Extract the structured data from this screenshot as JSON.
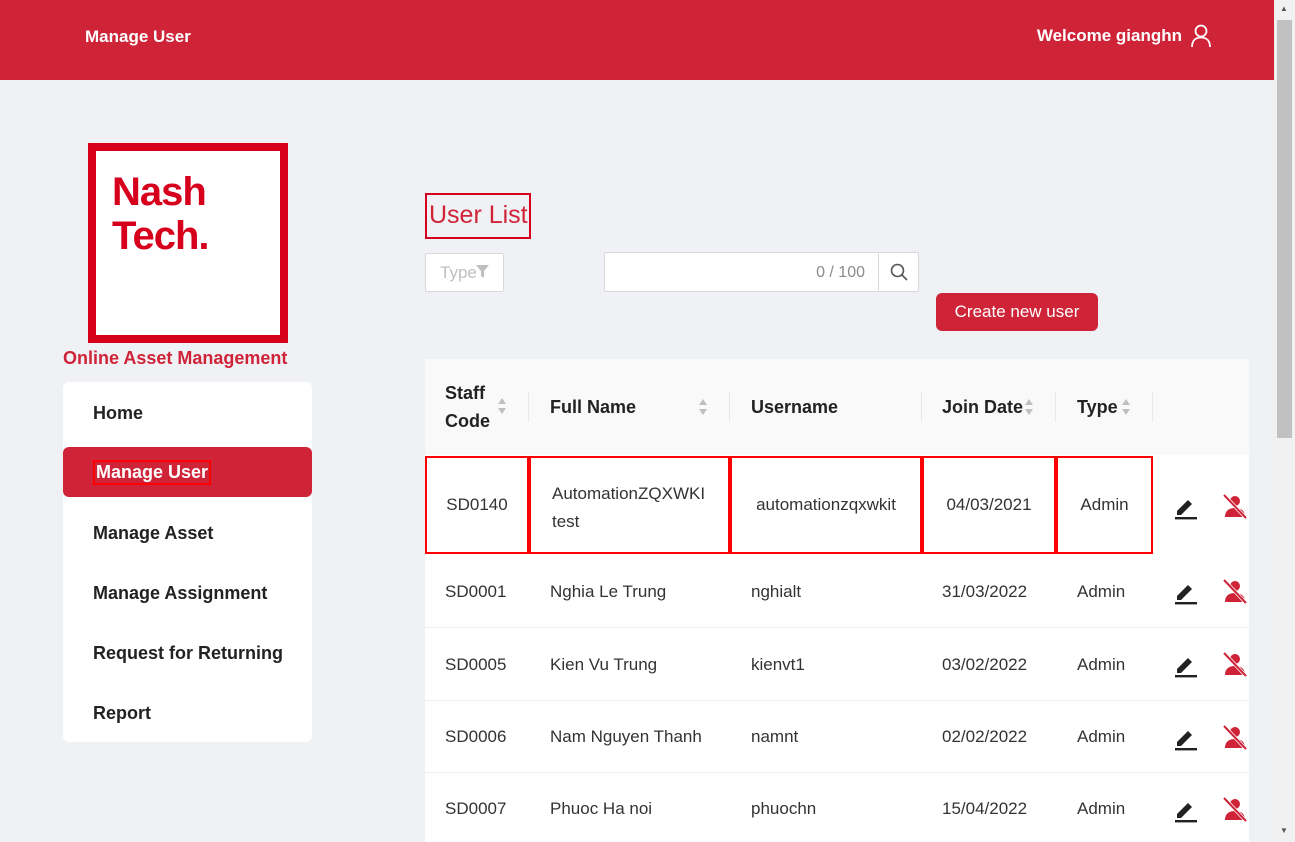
{
  "header": {
    "title": "Manage User",
    "welcome": "Welcome gianghn",
    "icon": "user-icon"
  },
  "logo": {
    "line1": "Nash",
    "line2": "Tech."
  },
  "app_name": "Online Asset Management",
  "nav": [
    {
      "label": "Home"
    },
    {
      "label": "Manage User",
      "active": true
    },
    {
      "label": "Manage Asset"
    },
    {
      "label": "Manage Assignment"
    },
    {
      "label": "Request for Returning"
    },
    {
      "label": "Report"
    }
  ],
  "page_title": "User List",
  "filter": {
    "placeholder": "Type"
  },
  "search": {
    "counter": "0 / 100"
  },
  "create_button": "Create new user",
  "table": {
    "columns": [
      "Staff Code",
      "Full Name",
      "Username",
      "Join Date",
      "Type"
    ],
    "column_lines": [
      [
        "Staff",
        "Code"
      ]
    ],
    "rows": [
      {
        "staff_code": "SD0140",
        "full_name_1": "AutomationZQXWKI",
        "full_name_2": "test",
        "username": "automationzqxwkit",
        "join_date": "04/03/2021",
        "type": "Admin"
      },
      {
        "staff_code": "SD0001",
        "full_name": "Nghia Le Trung",
        "username": "nghialt",
        "join_date": "31/03/2022",
        "type": "Admin"
      },
      {
        "staff_code": "SD0005",
        "full_name": "Kien Vu Trung",
        "username": "kienvt1",
        "join_date": "03/02/2022",
        "type": "Admin"
      },
      {
        "staff_code": "SD0006",
        "full_name": "Nam Nguyen Thanh",
        "username": "namnt",
        "join_date": "02/02/2022",
        "type": "Admin"
      },
      {
        "staff_code": "SD0007",
        "full_name": "Phuoc Ha noi",
        "username": "phuochn",
        "join_date": "15/04/2022",
        "type": "Admin"
      }
    ]
  },
  "colors": {
    "brand": "#cf2338",
    "logo_red": "#d6001c",
    "highlight": "#ff0000",
    "background": "#f0f1f5"
  }
}
